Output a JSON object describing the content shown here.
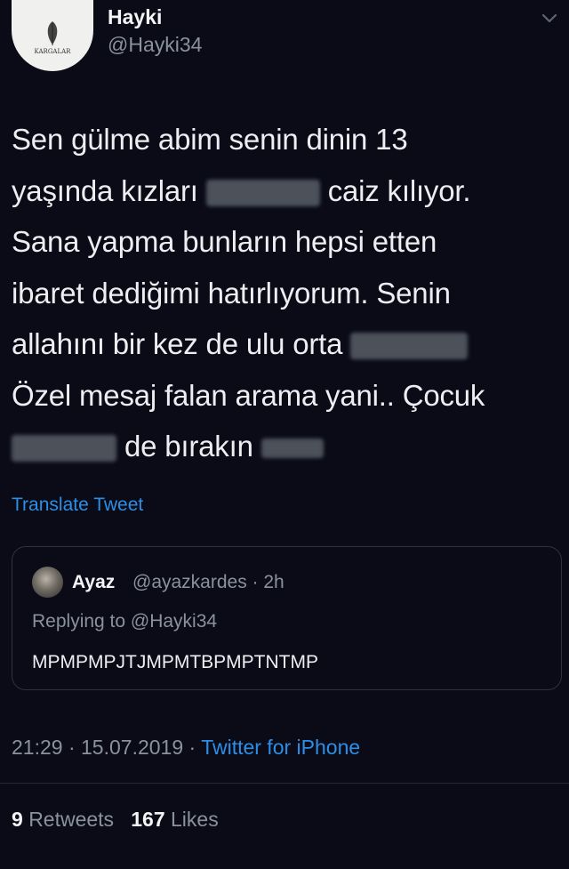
{
  "author": {
    "display_name": "Hayki",
    "handle": "@Hayki34",
    "avatar_text": "KARGALAR"
  },
  "tweet": {
    "lines": [
      "Sen gülme abim senin dinin 13",
      "yaşında kızları",
      "caiz kılıyor.",
      "Sana yapma bunların hepsi etten",
      "ibaret dediğimi hatırlıyorum. Senin",
      "allahını bir kez de ulu orta",
      "Özel mesaj falan arama yani.. Çocuk",
      "de bırakın"
    ],
    "translate_label": "Translate Tweet"
  },
  "quoted": {
    "name": "Ayaz",
    "handle_time": "@ayazkardes · 2h",
    "replying": "Replying to @Hayki34",
    "text": "MPMPMPJTJMPMTBPMPTNTMP"
  },
  "meta": {
    "time": "21:29",
    "date": "15.07.2019",
    "separator": "·",
    "source": "Twitter for iPhone"
  },
  "stats": {
    "retweets_count": "9",
    "retweets_label": "Retweets",
    "likes_count": "167",
    "likes_label": "Likes"
  },
  "colors": {
    "background": "#0a0b17",
    "link": "#2c8ee6",
    "muted": "#8a929c"
  },
  "icons": {
    "caret": "chevron-down-icon"
  }
}
